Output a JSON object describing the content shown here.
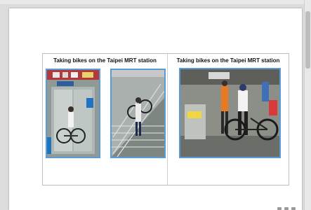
{
  "slide": {
    "left_title": "Taking bikes on the Taipei MRT station",
    "right_title": "Taking bikes on the Taipei MRT station"
  },
  "photos": [
    {
      "icon": "elevator-bike-photo"
    },
    {
      "icon": "stairs-bike-photo"
    },
    {
      "icon": "gate-bike-photo"
    }
  ],
  "colors": {
    "photo_border": "#5b9bd5",
    "page_bg": "#ffffff",
    "viewer_bg": "#dcdcdc"
  }
}
